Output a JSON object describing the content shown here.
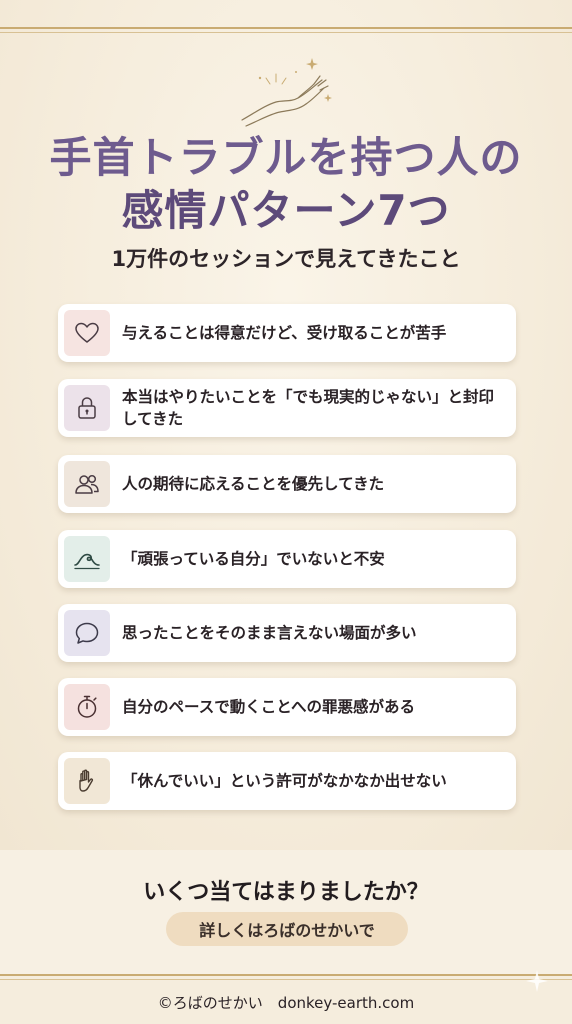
{
  "title": {
    "line1": "手首トラブルを持つ人の",
    "line2": "感情パターン7つ"
  },
  "subtitle": "1万件のセッションで見えてきたこと",
  "items": [
    {
      "label": "与えることは得意だけど、受け取ることが苦手",
      "icon": "heart-icon",
      "bg": "#f6e4e1"
    },
    {
      "label": "本当はやりたいことを「でも現実的じゃない」と封印してきた",
      "icon": "lock-icon",
      "bg": "#ece2ea"
    },
    {
      "label": "人の期待に応えることを優先してきた",
      "icon": "people-icon",
      "bg": "#efe6dc"
    },
    {
      "label": "「頑張っている自分」でいないと不安",
      "icon": "wave-icon",
      "bg": "#e3eee9"
    },
    {
      "label": "思ったことをそのまま言えない場面が多い",
      "icon": "speech-bubble-icon",
      "bg": "#e6e3ef"
    },
    {
      "label": "自分のペースで動くことへの罪悪感がある",
      "icon": "stopwatch-icon",
      "bg": "#f5e1df"
    },
    {
      "label": "「休んでいい」という許可がなかなか出せない",
      "icon": "raised-hand-icon",
      "bg": "#f1e7d6"
    }
  ],
  "cta": {
    "question": "いくつ当てはまりましたか？",
    "button": "詳しくはろばのせかいで"
  },
  "footer": "©ろばのせかい　donkey-earth.com",
  "colors": {
    "title": "#6e5b8e",
    "gold": "#c9ab72",
    "pill": "#efdcc0"
  }
}
